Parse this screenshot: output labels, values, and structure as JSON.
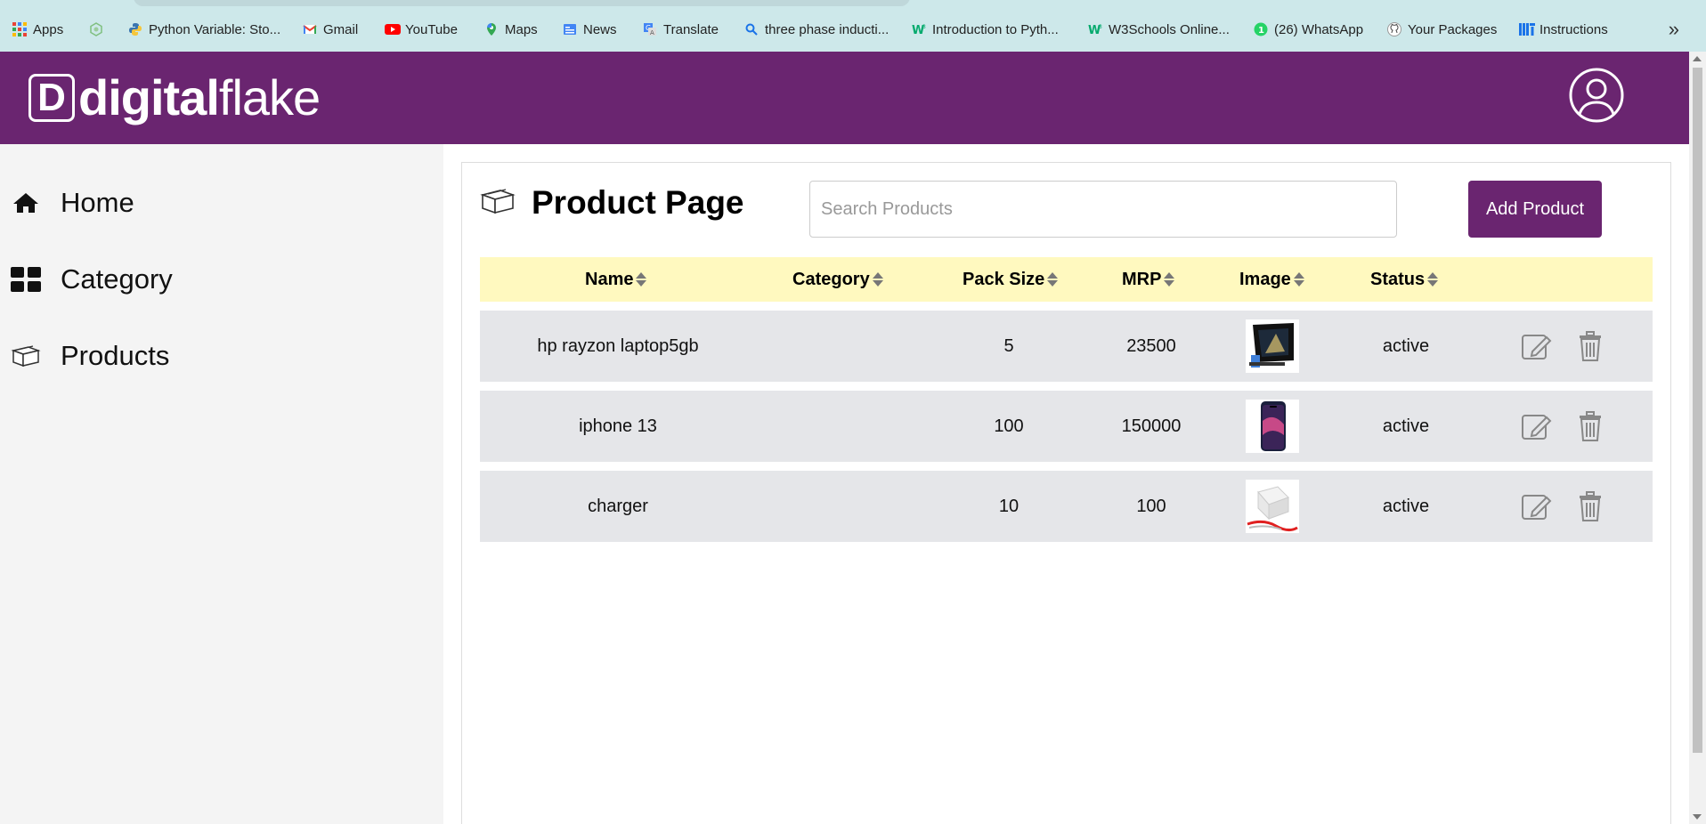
{
  "bookmarks": {
    "items": [
      {
        "label": "Apps",
        "icon": "apps-grid-icon"
      },
      {
        "label": "",
        "icon": "hexagon-extension-icon"
      },
      {
        "label": "Python Variable: Sto...",
        "icon": "python-icon"
      },
      {
        "label": "Gmail",
        "icon": "gmail-icon"
      },
      {
        "label": "YouTube",
        "icon": "youtube-icon"
      },
      {
        "label": "Maps",
        "icon": "maps-icon"
      },
      {
        "label": "News",
        "icon": "news-icon"
      },
      {
        "label": "Translate",
        "icon": "translate-icon"
      },
      {
        "label": "three phase inducti...",
        "icon": "search-icon"
      },
      {
        "label": "Introduction to Pyth...",
        "icon": "w3-icon"
      },
      {
        "label": "W3Schools Online...",
        "icon": "w3-icon"
      },
      {
        "label": "(26) WhatsApp",
        "icon": "whatsapp-icon"
      },
      {
        "label": "Your Packages",
        "icon": "github-icon"
      },
      {
        "label": "Instructions",
        "icon": "mit-icon"
      }
    ],
    "more": "»"
  },
  "header": {
    "logo_letter": "D",
    "logo_bold": "digital",
    "logo_light": "flake",
    "brand_color": "#6a2570"
  },
  "sidebar": {
    "items": [
      {
        "label": "Home",
        "icon": "home-icon"
      },
      {
        "label": "Category",
        "icon": "category-grid-icon"
      },
      {
        "label": "Products",
        "icon": "box-icon"
      }
    ]
  },
  "main": {
    "title": "Product Page",
    "search_placeholder": "Search Products",
    "add_label": "Add Product",
    "columns": [
      "Name",
      "Category",
      "Pack Size",
      "MRP",
      "Image",
      "Status"
    ],
    "rows": [
      {
        "name": "hp rayzon laptop5gb",
        "category": "",
        "pack_size": "5",
        "mrp": "23500",
        "image": "laptop-image",
        "status": "active"
      },
      {
        "name": "iphone 13",
        "category": "",
        "pack_size": "100",
        "mrp": "150000",
        "image": "phone-image",
        "status": "active"
      },
      {
        "name": "charger",
        "category": "",
        "pack_size": "10",
        "mrp": "100",
        "image": "charger-image",
        "status": "active"
      }
    ],
    "header_bg": "#fff9bf",
    "row_bg": "#e5e6e9"
  }
}
